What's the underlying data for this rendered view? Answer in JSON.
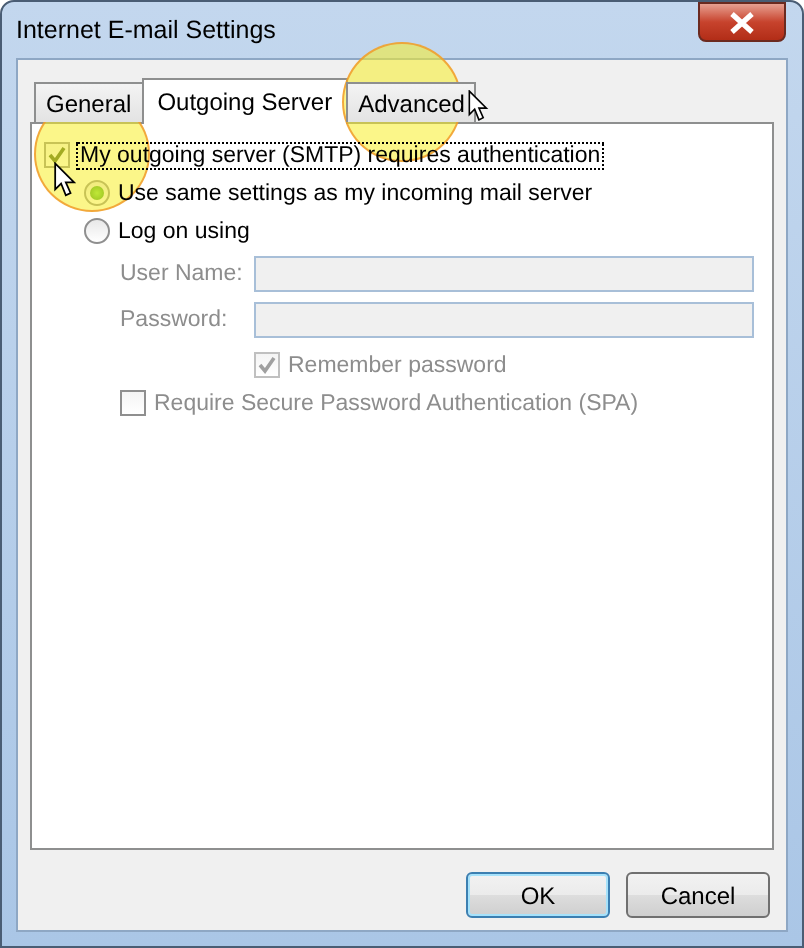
{
  "window": {
    "title": "Internet E-mail Settings"
  },
  "tabs": [
    {
      "label": "General",
      "selected": false
    },
    {
      "label": "Outgoing Server",
      "selected": true
    },
    {
      "label": "Advanced",
      "selected": false
    }
  ],
  "requires_auth": {
    "label": "My outgoing server (SMTP) requires authentication",
    "checked": true
  },
  "auth_options": [
    {
      "label": "Use same settings as my incoming mail server",
      "selected": true
    },
    {
      "label": "Log on using",
      "selected": false
    }
  ],
  "fields": [
    {
      "label": "User Name:",
      "disabled": true
    },
    {
      "label": "Password:",
      "disabled": true
    }
  ],
  "remember_password": {
    "label": "Remember password",
    "checked": true,
    "disabled": true
  },
  "spa": {
    "label": "Require Secure Password Authentication (SPA)",
    "checked": false
  },
  "buttons": [
    {
      "label": "OK",
      "default": true
    },
    {
      "label": "Cancel",
      "default": false
    }
  ]
}
